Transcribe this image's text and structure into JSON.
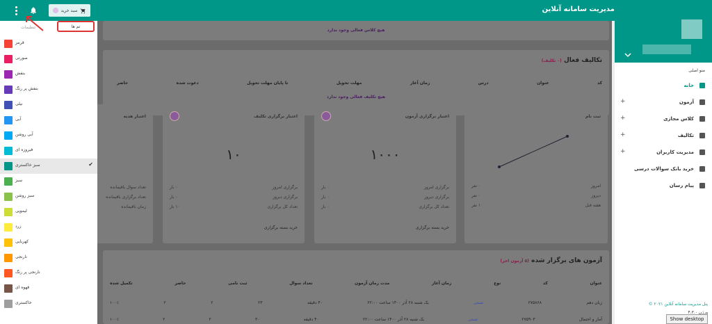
{
  "topbar": {
    "title": "پنل مدیریت سامانه آنلاین",
    "cart_label": "سبد خرید"
  },
  "theme_menu": {
    "header": "تنظیمات",
    "tab_label": "تم ها",
    "items": [
      {
        "label": "قرمز",
        "color": "#f44336"
      },
      {
        "label": "صورتی",
        "color": "#e91e63"
      },
      {
        "label": "بنفش",
        "color": "#9c27b0"
      },
      {
        "label": "بنفش پر رنگ",
        "color": "#673ab7"
      },
      {
        "label": "نیلی",
        "color": "#3f51b5"
      },
      {
        "label": "آبی",
        "color": "#2196f3"
      },
      {
        "label": "آبی روشن",
        "color": "#03a9f4"
      },
      {
        "label": "فیروزه ای",
        "color": "#00bcd4"
      },
      {
        "label": "سبز خاکستری",
        "color": "#009688",
        "selected": true
      },
      {
        "label": "سبز",
        "color": "#4caf50"
      },
      {
        "label": "سبز روشن",
        "color": "#8bc34a"
      },
      {
        "label": "لیمویی",
        "color": "#cddc39"
      },
      {
        "label": "زرد",
        "color": "#ffeb3b"
      },
      {
        "label": "کهربایی",
        "color": "#ffc107"
      },
      {
        "label": "نارنجی",
        "color": "#ff9800"
      },
      {
        "label": "نارنجی پر رنگ",
        "color": "#ff5722"
      },
      {
        "label": "قهوه ای",
        "color": "#795548"
      },
      {
        "label": "خاکستری",
        "color": "#9e9e9e"
      }
    ]
  },
  "active_classes": {
    "empty": "هیچ کلاس فعالی وجود ندارد"
  },
  "assignments": {
    "title": "تکالیف فعال",
    "subtitle": "(۰ تکلیف)",
    "columns": [
      "کد",
      "عنوان",
      "درس",
      "زمان آغاز",
      "مهلت تحویل",
      "تا پایان مهلت تحویل",
      "دعوت شده",
      "حاضر"
    ],
    "empty": "هیچ تکلیف فعالی وجود ندارد"
  },
  "stats": {
    "signup": {
      "title": "ثبت نام",
      "rows": [
        {
          "label": "امروز",
          "value": "۰ نفر"
        },
        {
          "label": "دیروز",
          "value": "۰ نفر"
        },
        {
          "label": "هفته قبل",
          "value": "۱ نفر"
        }
      ]
    },
    "exam_credit": {
      "title": "اعتبار برگزاری آزمون",
      "value": "۱۰۰۰",
      "rows": [
        {
          "label": "برگزاری امروز",
          "value": "۰ بار"
        },
        {
          "label": "برگزاری دیروز",
          "value": "۰ بار"
        },
        {
          "label": "تعداد کل برگزاری",
          "value": "۰ بار"
        }
      ],
      "footer": "خرید بسته برگزاری"
    },
    "assign_credit": {
      "title": "اعتبار برگزاری تکلیف",
      "value": "۱۰",
      "rows": [
        {
          "label": "برگزاری امروز",
          "value": "۰ بار"
        },
        {
          "label": "برگزاری دیروز",
          "value": "۰ بار"
        },
        {
          "label": "تعداد کل برگزاری",
          "value": "۱۰ بار"
        }
      ],
      "footer": "خرید بسته برگزاری"
    },
    "gift": {
      "title": "اعتبار هدیه",
      "rows": [
        {
          "label": "تعداد سوال باقیمانده",
          "value": ""
        },
        {
          "label": "تعداد برگزاری باقیمانده",
          "value": ""
        },
        {
          "label": "زمان باقیمانده",
          "value": ""
        }
      ]
    }
  },
  "held_exams": {
    "title": "آزمون های برگزار شده",
    "subtitle": "(۵ آزمون اخر)",
    "columns": [
      "عنوان",
      "کد",
      "نوع",
      "زمان آغاز",
      "مدت زمان آزمون",
      "تعداد سوال",
      "ثبت نامی",
      "حاضر",
      "تکمیل شده"
    ],
    "rows": [
      [
        "زبان دهم",
        "۲۷۵۸۶۸",
        "تستی",
        "یک شنبه ۲۸ آذر ۱۴۰۰ ساعت ۲۲:۰۰",
        "۴۰ دقیقه",
        "۲۳",
        "۲",
        "۲",
        "۱۰۰٪"
      ],
      [
        "آمار و احتمال",
        "۲۷۵۹۰۳",
        "تستی",
        "یک شنبه ۲۸ آذر ۱۴۰۰ ساعت ۲۲:۰۰",
        "۴۰ دقیقه",
        "۳۰",
        "۲",
        "۲",
        "۱۰۰٪"
      ]
    ]
  },
  "right_sidebar": {
    "menu_title": "منو اصلی",
    "items": [
      {
        "label": "خانه",
        "icon": "home-icon",
        "active": true,
        "expand": false
      },
      {
        "label": "آزمون",
        "icon": "exam-icon",
        "expand": true
      },
      {
        "label": "کلاس مجازی",
        "icon": "class-icon",
        "expand": true
      },
      {
        "label": "تکالیف",
        "icon": "clipboard-icon",
        "expand": true
      },
      {
        "label": "مدیریت کاربران",
        "icon": "users-icon",
        "expand": true
      },
      {
        "label": "خرید بانک سوالات درسی",
        "icon": "basket-icon",
        "expand": false
      },
      {
        "label": "پیام رسان",
        "icon": "mail-icon",
        "expand": false
      }
    ],
    "footer_line1": "پنل مدیریت سامانه آنلاین ۲۰۲۱ ©",
    "footer_line2": "ورژن ۴.۳.۰"
  },
  "tooltip": "Show desktop",
  "colors": {
    "accent": "#009688"
  }
}
